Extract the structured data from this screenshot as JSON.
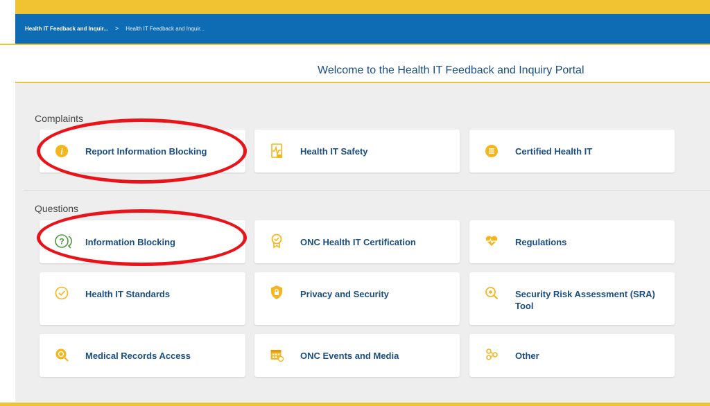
{
  "breadcrumbs": [
    "Health IT Feedback and Inquir...",
    ">",
    "Health IT Feedback and Inquir..."
  ],
  "welcome_title": "Welcome to the Health IT Feedback and Inquiry Portal",
  "complaints": {
    "heading": "Complaints",
    "cards": [
      {
        "label": "Report Information Blocking",
        "icon": "info-circle-icon"
      },
      {
        "label": "Health IT Safety",
        "icon": "document-pulse-icon"
      },
      {
        "label": "Certified Health IT",
        "icon": "list-circle-icon"
      }
    ]
  },
  "questions": {
    "heading": "Questions",
    "cards": [
      {
        "label": "Information Blocking",
        "icon": "question-speech-icon"
      },
      {
        "label": "ONC Health IT Certification",
        "icon": "award-badge-icon"
      },
      {
        "label": "Regulations",
        "icon": "heart-pulse-icon"
      },
      {
        "label": "Health IT Standards",
        "icon": "check-circle-icon"
      },
      {
        "label": "Privacy and Security",
        "icon": "shield-lock-icon"
      },
      {
        "label": "Security Risk Assessment (SRA) Tool",
        "icon": "magnifier-plus-icon"
      },
      {
        "label": "Medical Records Access",
        "icon": "records-search-icon"
      },
      {
        "label": "ONC Events and Media",
        "icon": "calendar-icon"
      },
      {
        "label": "Other",
        "icon": "molecule-icon"
      }
    ]
  },
  "colors": {
    "accent_yellow": "#f1c232",
    "nav_blue": "#0d6cb3",
    "text_blue": "#1a4d80",
    "annotation_red": "#e8141a",
    "icon_yellow": "#f5b51c"
  }
}
